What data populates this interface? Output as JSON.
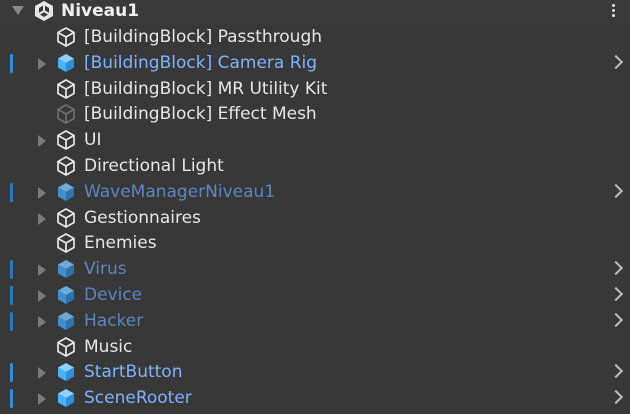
{
  "scene": {
    "name": "Niveau1",
    "menu_icon": "kebab-menu-icon"
  },
  "colors": {
    "prefab_text": "#7db3ff",
    "prefab_dim_text": "#5b86c2",
    "disabled_text": "#7b7b7b",
    "prefab_bar": "#2f8fd8",
    "background": "#383838"
  },
  "hierarchy": {
    "items": [
      {
        "label": "[BuildingBlock] Passthrough",
        "kind": "gameobject",
        "expandable": false,
        "prefab": false
      },
      {
        "label": "[BuildingBlock] Camera Rig",
        "kind": "prefab",
        "expandable": true,
        "prefab": true
      },
      {
        "label": "[BuildingBlock] MR Utility Kit",
        "kind": "gameobject",
        "expandable": false,
        "prefab": false
      },
      {
        "label": "[BuildingBlock] Effect Mesh",
        "kind": "gameobject-disabled",
        "expandable": false,
        "prefab": false
      },
      {
        "label": "UI",
        "kind": "gameobject",
        "expandable": true,
        "prefab": false
      },
      {
        "label": "Directional Light",
        "kind": "gameobject",
        "expandable": false,
        "prefab": false
      },
      {
        "label": "WaveManagerNiveau1",
        "kind": "prefab-dim",
        "expandable": true,
        "prefab": true
      },
      {
        "label": "Gestionnaires",
        "kind": "gameobject",
        "expandable": true,
        "prefab": false
      },
      {
        "label": "Enemies",
        "kind": "gameobject",
        "expandable": false,
        "prefab": false
      },
      {
        "label": "Virus",
        "kind": "prefab-dim",
        "expandable": true,
        "prefab": true
      },
      {
        "label": "Device",
        "kind": "prefab-dim",
        "expandable": true,
        "prefab": true
      },
      {
        "label": "Hacker",
        "kind": "prefab-dim",
        "expandable": true,
        "prefab": true
      },
      {
        "label": "Music",
        "kind": "gameobject",
        "expandable": false,
        "prefab": false
      },
      {
        "label": "StartButton",
        "kind": "prefab",
        "expandable": true,
        "prefab": true
      },
      {
        "label": "SceneRooter",
        "kind": "prefab",
        "expandable": true,
        "prefab": true
      }
    ]
  }
}
